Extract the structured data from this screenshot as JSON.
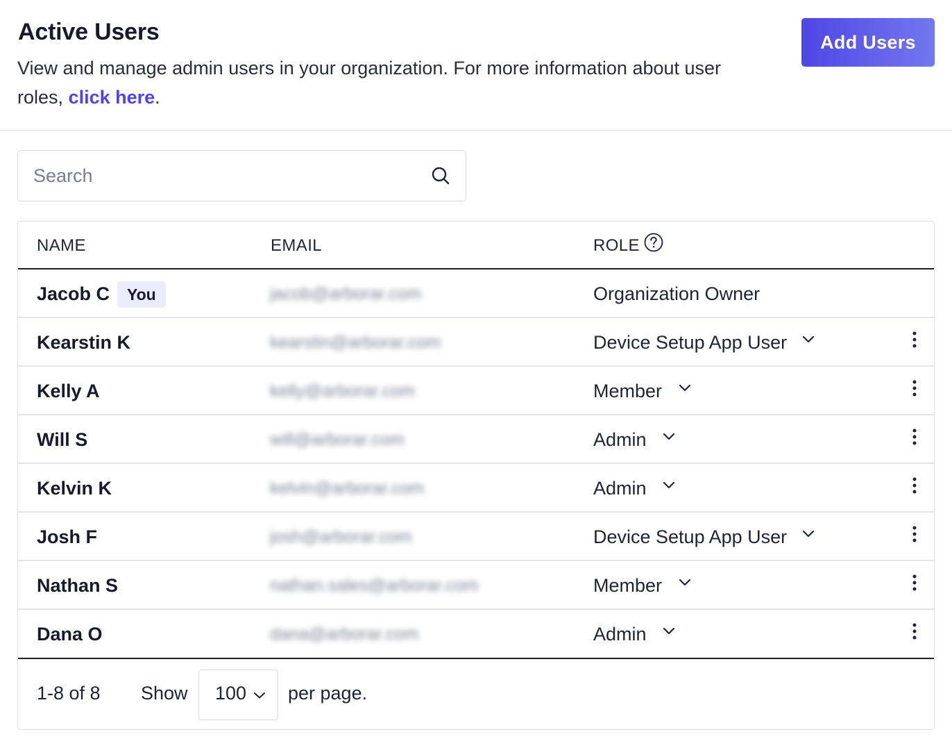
{
  "header": {
    "title": "Active Users",
    "description": "View and manage admin users in your organization. For more information about user roles,",
    "link_text": "click here",
    "description_end": ".",
    "add_button": "Add Users"
  },
  "search": {
    "placeholder": "Search"
  },
  "table": {
    "columns": {
      "name": "NAME",
      "email": "EMAIL",
      "role": "ROLE"
    },
    "you_badge": "You",
    "rows": [
      {
        "name": "Jacob C",
        "email": "jacob@arborar.com",
        "role": "Organization Owner",
        "is_you": true
      },
      {
        "name": "Kearstin K",
        "email": "kearstin@arborar.com",
        "role": "Device Setup App User"
      },
      {
        "name": "Kelly A",
        "email": "kelly@arborar.com",
        "role": "Member"
      },
      {
        "name": "Will S",
        "email": "will@arborar.com",
        "role": "Admin"
      },
      {
        "name": "Kelvin K",
        "email": "kelvin@arborar.com",
        "role": "Admin"
      },
      {
        "name": "Josh F",
        "email": "josh@arborar.com",
        "role": "Device Setup App User"
      },
      {
        "name": "Nathan S",
        "email": "nathan.sales@arborar.com",
        "role": "Member"
      },
      {
        "name": "Dana O",
        "email": "dana@arborar.com",
        "role": "Admin"
      }
    ]
  },
  "pagination": {
    "count": "1-8 of 8",
    "show_label": "Show",
    "per_page_value": "100",
    "per_page_label": "per page."
  },
  "colors": {
    "accent": "#4f46e5",
    "link": "#5044e4",
    "badge_bg": "#ecebfb"
  }
}
